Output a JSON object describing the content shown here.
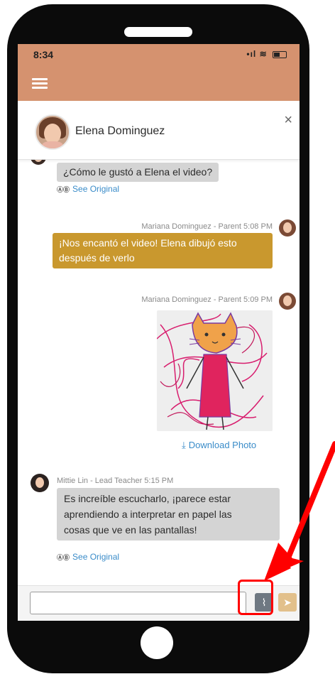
{
  "status_bar": {
    "time": "8:34",
    "signal": "•ıl",
    "wifi": "≋"
  },
  "header": {
    "name": "Elena Dominguez",
    "close_glyph": "×"
  },
  "messages": [
    {
      "sender": "",
      "role": "",
      "time": "",
      "text": "¿Cómo le gustó a Elena el video?",
      "link": "See Original"
    },
    {
      "sender_line": "Mariana Dominguez - Parent 5:08 PM",
      "line1": "¡Nos encantó el video! Elena dibujó esto",
      "line2": "después de verlo"
    },
    {
      "sender_line": "Mariana Dominguez - Parent 5:09 PM",
      "download_label": "Download Photo"
    },
    {
      "sender_line": "Mittie Lin - Lead Teacher 5:15 PM",
      "line1": "Es increíble escucharlo, ¡parece estar",
      "line2": "aprendiendo a interpretar en papel las",
      "line3": "cosas que ve en las pantallas!",
      "link": "See Original"
    }
  ],
  "composer": {
    "input_value": "",
    "placeholder": "",
    "attach_glyph": "⌇",
    "send_glyph": "➤"
  },
  "icons": {
    "translate_icon": "ⒶⒷ",
    "download_icon": "⤓"
  },
  "colors": {
    "brand": "#d5926f",
    "parent_bubble": "#c9982e",
    "other_bubble": "#d4d4d4",
    "link": "#3a8cc9",
    "highlight": "#ff0000"
  }
}
